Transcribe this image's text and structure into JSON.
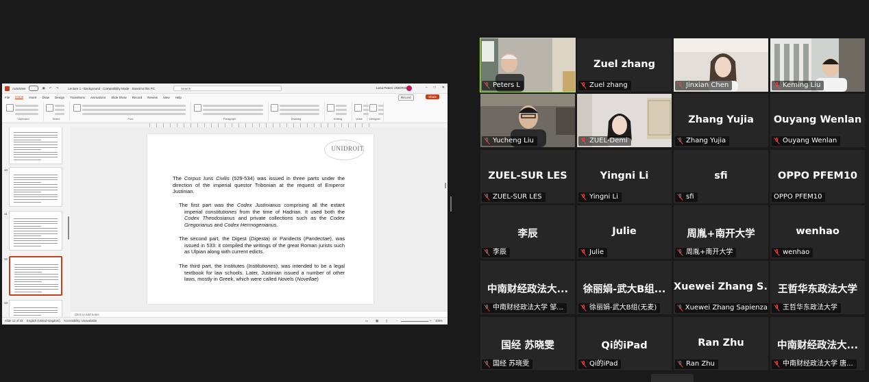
{
  "powerpoint": {
    "autosave": "AutoSave",
    "doc_title": "Lecture 1 - Background · Compatibility Mode · Saved to this PC",
    "search_placeholder": "Search",
    "user_name": "Lena Peters UNIDROIT",
    "tabs": [
      "File",
      "Home",
      "Insert",
      "Draw",
      "Design",
      "Transitions",
      "Animations",
      "Slide Show",
      "Record",
      "Review",
      "View",
      "Help"
    ],
    "active_tab": "Home",
    "record_label": "Record",
    "share_label": "Share",
    "ribbon_groups": [
      "Clipboard",
      "Slides",
      "Font",
      "Paragraph",
      "Drawing",
      "Editing",
      "Voice",
      "Designer"
    ],
    "thumbnails": [
      {
        "num": "",
        "selected": false
      },
      {
        "num": "10",
        "selected": false
      },
      {
        "num": "11",
        "selected": false
      },
      {
        "num": "12",
        "selected": true
      },
      {
        "num": "13",
        "selected": false
      }
    ],
    "slide": {
      "logo": "UNIDROIT",
      "para1_html": "The <i>Corpus Iuris Civilis</i> (529-534) was issued in three parts under the direction of the imperial questor Tribonian at the request of Emperor Justinian.",
      "para2_html": "The first part was the <i>Codex Justinianus</i> comprising all the extant imperial <i>constitutiones</i> from the time of Hadrian. It used both the <i>Codex Theodosianus</i> and private collections such as the <i>Codex Gregorianus</i> and <i>Codex Hermogenianus</i>.",
      "para3_html": "The second part, the Digest (<i>Digesta</i>) or Pandects (<i>Pandectae</i>), was issued in 533: it compiled the writings of the great Roman jurists such as Ulpian along with current edicts.",
      "para4_html": "The third part, the Institutes (<i>Institutiones</i>), was intended to be a legal textbook for law schools. Later, Justinian issued a number of other laws, mostly in Greek, which were called Novels (<i>Novellae</i>)"
    },
    "notes_placeholder": "Click to add notes",
    "status": {
      "slide_counter": "Slide 12 of 33",
      "language": "English (United Kingdom)",
      "accessibility": "Accessibility: Unavailable",
      "zoom": "106%"
    }
  },
  "gallery": [
    {
      "name": "Peters L",
      "big": "",
      "photo": "peters",
      "muted": true,
      "active": true
    },
    {
      "name": "Zuel zhang",
      "big": "Zuel zhang",
      "photo": "",
      "muted": true,
      "active": false
    },
    {
      "name": "Jinxian Chen",
      "big": "",
      "photo": "jinxian",
      "muted": true,
      "active": false
    },
    {
      "name": "Keming Liu",
      "big": "",
      "photo": "keming",
      "muted": true,
      "active": false
    },
    {
      "name": "Yucheng Liu",
      "big": "",
      "photo": "yucheng",
      "muted": true,
      "active": false
    },
    {
      "name": "ZUEL-Demi",
      "big": "",
      "photo": "demi",
      "muted": true,
      "active": false
    },
    {
      "name": "Zhang Yujia",
      "big": "Zhang Yujia",
      "photo": "",
      "muted": true,
      "active": false
    },
    {
      "name": "Ouyang Wenlan",
      "big": "Ouyang Wenlan",
      "photo": "",
      "muted": true,
      "active": false
    },
    {
      "name": "ZUEL-SUR LES",
      "big": "ZUEL-SUR LES",
      "photo": "",
      "muted": true,
      "active": false
    },
    {
      "name": "Yingni Li",
      "big": "Yingni Li",
      "photo": "",
      "muted": true,
      "active": false
    },
    {
      "name": "sfi",
      "big": "sfi",
      "photo": "",
      "muted": true,
      "active": false
    },
    {
      "name": "OPPO PFEM10",
      "big": "OPPO PFEM10",
      "photo": "",
      "muted": false,
      "active": false
    },
    {
      "name": "李辰",
      "big": "李辰",
      "photo": "",
      "muted": true,
      "active": false
    },
    {
      "name": "Julie",
      "big": "Julie",
      "photo": "",
      "muted": true,
      "active": false
    },
    {
      "name": "周胤+南开大学",
      "big": "周胤+南开大学",
      "photo": "",
      "muted": true,
      "active": false
    },
    {
      "name": "wenhao",
      "big": "wenhao",
      "photo": "",
      "muted": true,
      "active": false
    },
    {
      "name": "中南财经政法大学 邹...",
      "big": "中南财经政法大...",
      "photo": "",
      "muted": true,
      "active": false
    },
    {
      "name": "徐丽娟-武大B组(无麦)",
      "big": "徐丽娟-武大B组...",
      "photo": "",
      "muted": true,
      "active": false
    },
    {
      "name": "Xuewei Zhang Sapienza",
      "big": "Xuewei Zhang S...",
      "photo": "",
      "muted": true,
      "active": false
    },
    {
      "name": "王哲华东政法大学",
      "big": "王哲华东政法大学",
      "photo": "",
      "muted": true,
      "active": false
    },
    {
      "name": "国经 苏晓雯",
      "big": "国经 苏晓雯",
      "photo": "",
      "muted": true,
      "active": false
    },
    {
      "name": "Qi的iPad",
      "big": "Qi的iPad",
      "photo": "",
      "muted": true,
      "active": false
    },
    {
      "name": "Ran Zhu",
      "big": "Ran Zhu",
      "photo": "",
      "muted": true,
      "active": false
    },
    {
      "name": "中南财经政法大学 唐...",
      "big": "中南财经政法大...",
      "photo": "",
      "muted": true,
      "active": false
    }
  ]
}
